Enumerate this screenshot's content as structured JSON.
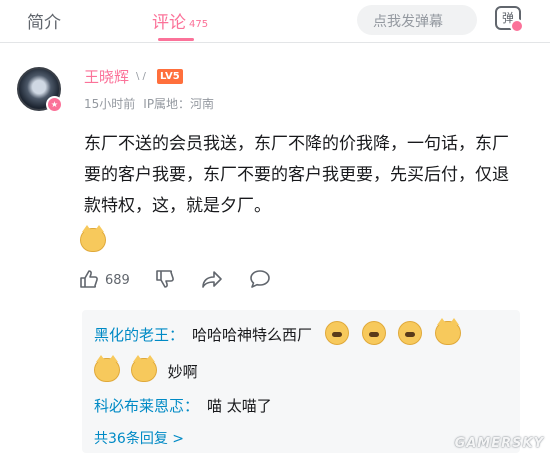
{
  "tabs": {
    "intro_label": "简介",
    "comments_label": "评论",
    "comments_count": "475"
  },
  "danmaku": {
    "placeholder": "点我发弹幕",
    "toggle_label": "弹"
  },
  "comment": {
    "username": "王晓辉",
    "user_tag": "\\ /",
    "level": "LV5",
    "time": "15小时前",
    "ip_location": "IP属地：河南",
    "text": "东厂不送的会员我送，东厂不降的价我降，一句话，东厂要的客户我要，东厂不要的客户我更要，先买后付，仅退款特权，这，就是夕厂。",
    "like_count": "689"
  },
  "replies": [
    {
      "name": "黑化的老王：",
      "text": "哈哈哈神特么西厂"
    },
    {
      "name": "",
      "text": "妙啊"
    },
    {
      "name": "科必布莱恩忑：",
      "text": "喵 太喵了"
    }
  ],
  "more_replies": "共36条回复 >",
  "watermark": "GAMERSKY",
  "colors": {
    "accent": "#fb7299",
    "link": "#008ac5",
    "level": "#ff6f3c"
  }
}
